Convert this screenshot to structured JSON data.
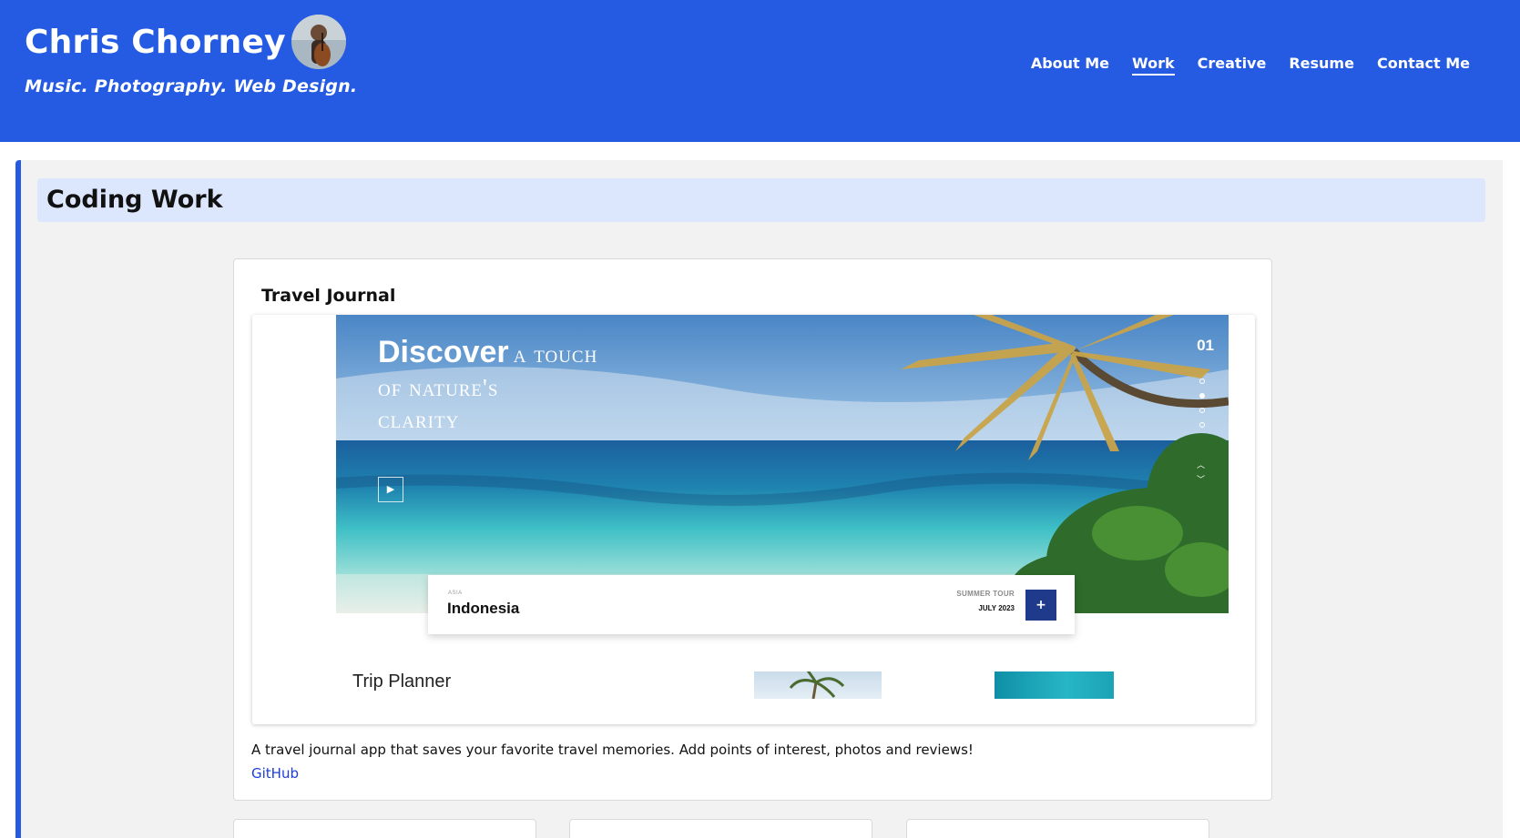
{
  "header": {
    "name": "Chris Chorney",
    "tagline": "Music. Photography. Web Design.",
    "avatar_icon": "portrait-photo"
  },
  "nav": {
    "items": [
      {
        "label": "About Me",
        "active": false
      },
      {
        "label": "Work",
        "active": true
      },
      {
        "label": "Creative",
        "active": false
      },
      {
        "label": "Resume",
        "active": false
      },
      {
        "label": "Contact Me",
        "active": false
      }
    ]
  },
  "section": {
    "title": "Coding Work"
  },
  "project": {
    "title": "Travel Journal",
    "screenshot": {
      "headline_bold": "Discover",
      "headline_rest1": "a touch",
      "headline_rest2": "of nature's",
      "headline_rest3": "clarity",
      "slide_number": "01",
      "region": "ASIA",
      "destination": "Indonesia",
      "tour_label": "SUMMER TOUR",
      "tour_date": "JULY 2023",
      "plus_label": "+",
      "planner_title": "Trip Planner"
    },
    "description": "A travel journal app that saves your favorite travel memories. Add points of interest, photos and reviews!",
    "link_label": "GitHub"
  },
  "colors": {
    "header_bg": "#255be3",
    "section_bg": "#f2f2f2",
    "title_bar_bg": "#dce7fd",
    "link": "#1a3ed6",
    "button_navy": "#1f3a8a"
  }
}
